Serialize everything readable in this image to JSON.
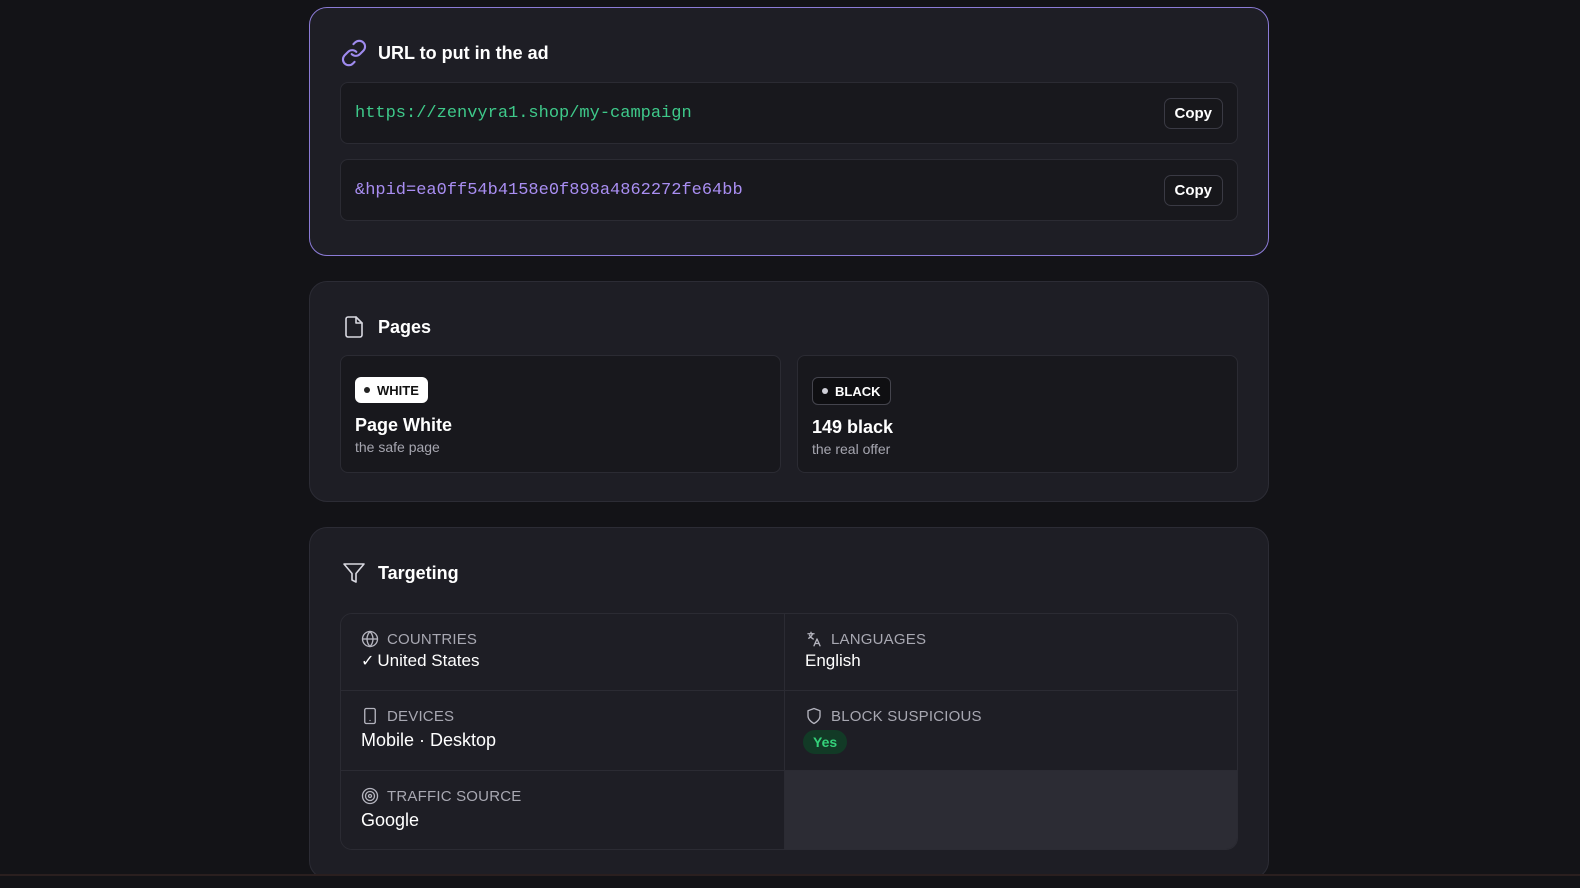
{
  "url_card": {
    "title": "URL to put in the ad",
    "icon": "link-icon",
    "base_url": "https://zenvyra1.shop/my-campaign",
    "param": "&hpid=ea0ff54b4158e0f898a4862272fe64bb",
    "copy_label_1": "Copy",
    "copy_label_2": "Copy"
  },
  "pages_card": {
    "title": "Pages",
    "icon": "file-icon",
    "white": {
      "badge": "WHITE",
      "name": "Page White",
      "desc": "the safe page"
    },
    "black": {
      "badge": "BLACK",
      "name": "149 black",
      "desc": "the real offer"
    }
  },
  "targeting_card": {
    "title": "Targeting",
    "icon": "filter-icon",
    "countries": {
      "label": "COUNTRIES",
      "check": "✓",
      "value": "United States"
    },
    "languages": {
      "label": "LANGUAGES",
      "value": "English"
    },
    "devices": {
      "label": "DEVICES",
      "value": "Mobile · Desktop"
    },
    "block_suspicious": {
      "label": "BLOCK SUSPICIOUS",
      "value": "Yes"
    },
    "traffic_source": {
      "label": "TRAFFIC SOURCE",
      "value": "Google"
    }
  },
  "colors": {
    "accent_border": "#8b7bd6",
    "url_green": "#3ec98a",
    "url_purple": "#a98ef2",
    "yes_green": "#34d27a"
  }
}
